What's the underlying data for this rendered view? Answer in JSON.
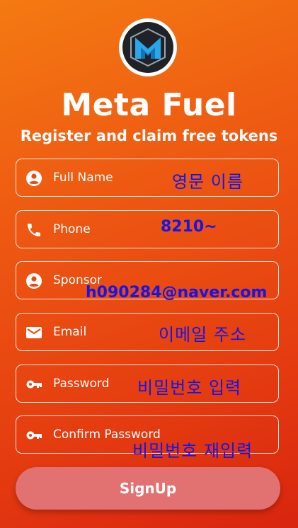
{
  "app": {
    "title": "Meta Fuel",
    "subtitle": "Register and claim free tokens"
  },
  "form": {
    "fields": [
      {
        "label": "Full Name",
        "icon": "person-icon"
      },
      {
        "label": "Phone",
        "icon": "phone-icon"
      },
      {
        "label": "Sponsor",
        "icon": "person-icon"
      },
      {
        "label": "Email",
        "icon": "email-icon"
      },
      {
        "label": "Password",
        "icon": "key-icon"
      },
      {
        "label": "Confirm Password",
        "icon": "key-icon"
      }
    ],
    "submit_label": "SignUp"
  },
  "annotations": {
    "full_name": "영문 이름",
    "phone": "8210~",
    "sponsor": "h090284@naver.com",
    "email": "이메일 주소",
    "password": "비밀번호 입력",
    "confirm_password": "비밀번호 재입력"
  },
  "colors": {
    "gradient_top": "#f47a12",
    "gradient_bottom": "#d8250f",
    "button": "#e27171",
    "annotation": "#1515e8"
  }
}
